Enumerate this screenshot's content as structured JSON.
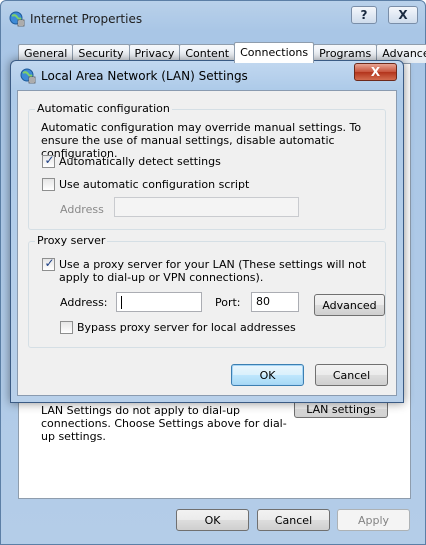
{
  "outer": {
    "title": "Internet Properties",
    "help_label": "?",
    "close_label": "X",
    "tabs": [
      "General",
      "Security",
      "Privacy",
      "Content",
      "Connections",
      "Programs",
      "Advanced"
    ],
    "active_tab": "Connections",
    "lan_note": "LAN Settings do not apply to dial-up connections. Choose Settings above for dial-up settings.",
    "lan_settings_label": "LAN settings",
    "ok_label": "OK",
    "cancel_label": "Cancel",
    "apply_label": "Apply"
  },
  "dialog": {
    "title": "Local Area Network (LAN) Settings",
    "close_label": "X",
    "auto_config": {
      "legend": "Automatic configuration",
      "description": "Automatic configuration may override manual settings.  To ensure the use of manual settings, disable automatic configuration.",
      "auto_detect_label": "Automatically detect settings",
      "auto_detect_checked": true,
      "use_script_label": "Use automatic configuration script",
      "use_script_checked": false,
      "address_label": "Address",
      "address_value": ""
    },
    "proxy": {
      "legend": "Proxy server",
      "use_proxy_label": "Use a proxy server for your LAN (These settings will not apply to dial-up or VPN connections).",
      "use_proxy_checked": true,
      "address_label": "Address:",
      "address_value": "",
      "port_label": "Port:",
      "port_value": "80",
      "advanced_label": "Advanced",
      "bypass_label": "Bypass proxy server for local addresses",
      "bypass_checked": false
    },
    "ok_label": "OK",
    "cancel_label": "Cancel"
  },
  "icons": {
    "window_icon": "internet-options-globe-icon",
    "check_glyph": "✓"
  }
}
